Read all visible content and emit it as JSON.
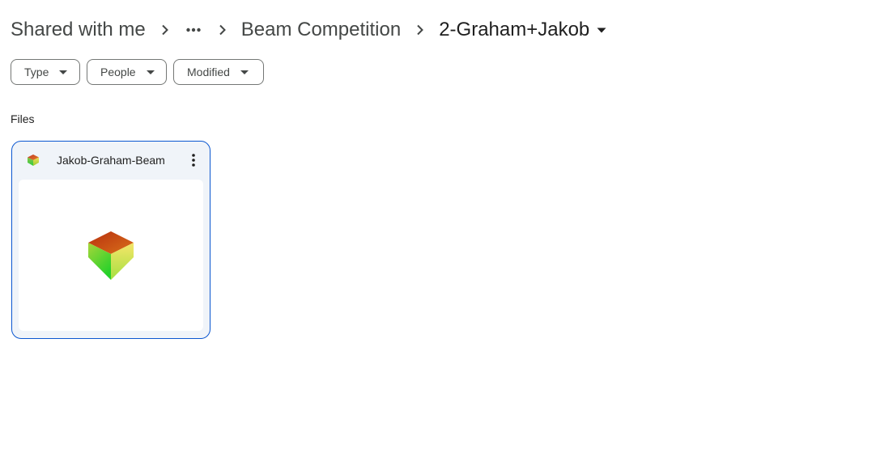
{
  "breadcrumb": {
    "root": "Shared with me",
    "more_icon": "more-horiz-icon",
    "parent": "Beam Competition",
    "current": "2-Graham+Jakob"
  },
  "filters": {
    "type": "Type",
    "people": "People",
    "modified": "Modified"
  },
  "section": {
    "files_label": "Files"
  },
  "files": [
    {
      "name": "Jakob-Graham-Beam",
      "type_icon": "3d-model-icon"
    }
  ],
  "colors": {
    "card_border": "#0b57d0",
    "card_bg": "#f0f4f9",
    "chip_border": "#747775",
    "text_secondary": "#444746",
    "text_primary": "#1f1f1f"
  }
}
